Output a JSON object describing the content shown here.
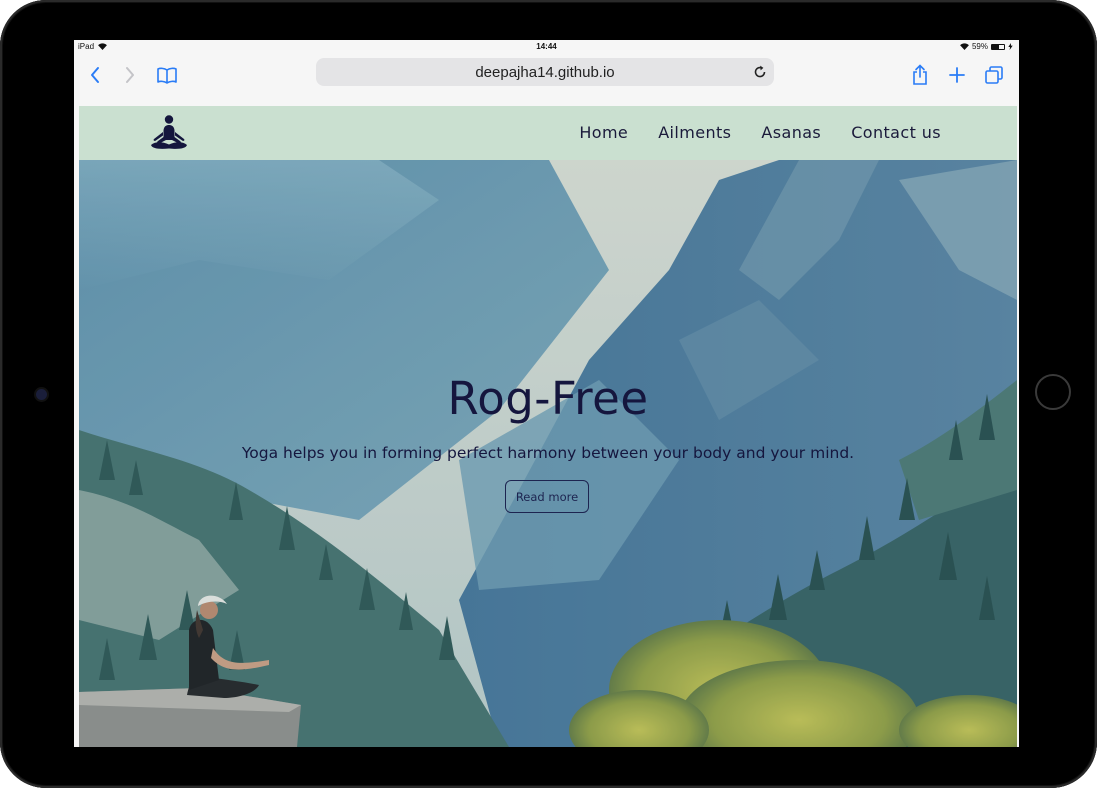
{
  "device": {
    "model_label": "iPad"
  },
  "status_bar": {
    "time": "14:44",
    "battery": "59%",
    "battery_level": 0.59
  },
  "browser": {
    "url": "deepajha14.github.io",
    "icons": [
      "back-icon",
      "forward-icon",
      "bookmarks-icon",
      "reload-icon",
      "share-icon",
      "new-tab-icon",
      "tabs-icon"
    ]
  },
  "site": {
    "nav": {
      "logo_icon": "meditation-icon",
      "items": [
        "Home",
        "Ailments",
        "Asanas",
        "Contact us"
      ]
    },
    "hero": {
      "title": "Rog-Free",
      "subtitle": "Yoga helps you in forming perfect harmony between your body and your mind.",
      "button_label": "Read more"
    }
  },
  "colors": {
    "navbar_bg": "#cae0d0",
    "nav_text": "#1a1a3a",
    "hero_text": "#15163e"
  }
}
